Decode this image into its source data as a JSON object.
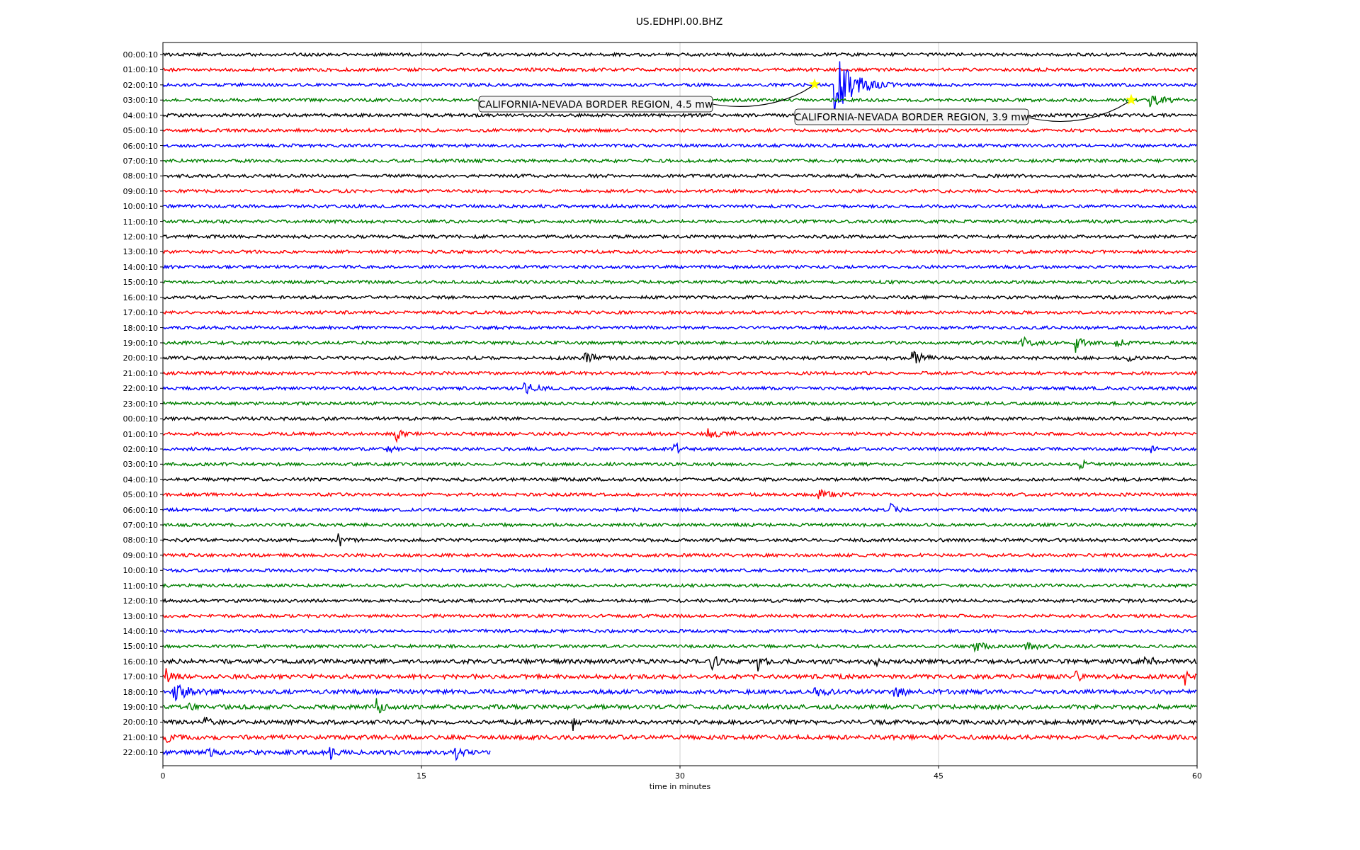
{
  "title": "US.EDHPI.00.BHZ",
  "rows": [
    {
      "label": "00:00:10",
      "color": "#000000"
    },
    {
      "label": "01:00:10",
      "color": "#ff0000"
    },
    {
      "label": "02:00:10",
      "color": "#0000ff"
    },
    {
      "label": "03:00:10",
      "color": "#008000"
    },
    {
      "label": "04:00:10",
      "color": "#000000"
    },
    {
      "label": "05:00:10",
      "color": "#ff0000"
    },
    {
      "label": "06:00:10",
      "color": "#0000ff"
    },
    {
      "label": "07:00:10",
      "color": "#008000"
    },
    {
      "label": "08:00:10",
      "color": "#000000"
    },
    {
      "label": "09:00:10",
      "color": "#ff0000"
    },
    {
      "label": "10:00:10",
      "color": "#0000ff"
    },
    {
      "label": "11:00:10",
      "color": "#008000"
    },
    {
      "label": "12:00:10",
      "color": "#000000"
    },
    {
      "label": "13:00:10",
      "color": "#ff0000"
    },
    {
      "label": "14:00:10",
      "color": "#0000ff"
    },
    {
      "label": "15:00:10",
      "color": "#008000"
    },
    {
      "label": "16:00:10",
      "color": "#000000"
    },
    {
      "label": "17:00:10",
      "color": "#ff0000"
    },
    {
      "label": "18:00:10",
      "color": "#0000ff"
    },
    {
      "label": "19:00:10",
      "color": "#008000"
    },
    {
      "label": "20:00:10",
      "color": "#000000"
    },
    {
      "label": "21:00:10",
      "color": "#ff0000"
    },
    {
      "label": "22:00:10",
      "color": "#0000ff"
    },
    {
      "label": "23:00:10",
      "color": "#008000"
    },
    {
      "label": "00:00:10",
      "color": "#000000"
    },
    {
      "label": "01:00:10",
      "color": "#ff0000"
    },
    {
      "label": "02:00:10",
      "color": "#0000ff"
    },
    {
      "label": "03:00:10",
      "color": "#008000"
    },
    {
      "label": "04:00:10",
      "color": "#000000"
    },
    {
      "label": "05:00:10",
      "color": "#ff0000"
    },
    {
      "label": "06:00:10",
      "color": "#0000ff"
    },
    {
      "label": "07:00:10",
      "color": "#008000"
    },
    {
      "label": "08:00:10",
      "color": "#000000"
    },
    {
      "label": "09:00:10",
      "color": "#ff0000"
    },
    {
      "label": "10:00:10",
      "color": "#0000ff"
    },
    {
      "label": "11:00:10",
      "color": "#008000"
    },
    {
      "label": "12:00:10",
      "color": "#000000"
    },
    {
      "label": "13:00:10",
      "color": "#ff0000"
    },
    {
      "label": "14:00:10",
      "color": "#0000ff"
    },
    {
      "label": "15:00:10",
      "color": "#008000"
    },
    {
      "label": "16:00:10",
      "color": "#000000"
    },
    {
      "label": "17:00:10",
      "color": "#ff0000"
    },
    {
      "label": "18:00:10",
      "color": "#0000ff"
    },
    {
      "label": "19:00:10",
      "color": "#008000"
    },
    {
      "label": "20:00:10",
      "color": "#000000"
    },
    {
      "label": "21:00:10",
      "color": "#ff0000"
    },
    {
      "label": "22:00:10",
      "color": "#0000ff"
    }
  ],
  "x_axis": {
    "label": "time in minutes",
    "ticks": [
      "0",
      "15",
      "30",
      "45",
      "60"
    ]
  },
  "annotations": [
    {
      "text": "CALIFORNIA-NEVADA BORDER REGION, 4.5 mw"
    },
    {
      "text": "CALIFORNIA-NEVADA BORDER REGION, 3.9 mw"
    }
  ]
}
